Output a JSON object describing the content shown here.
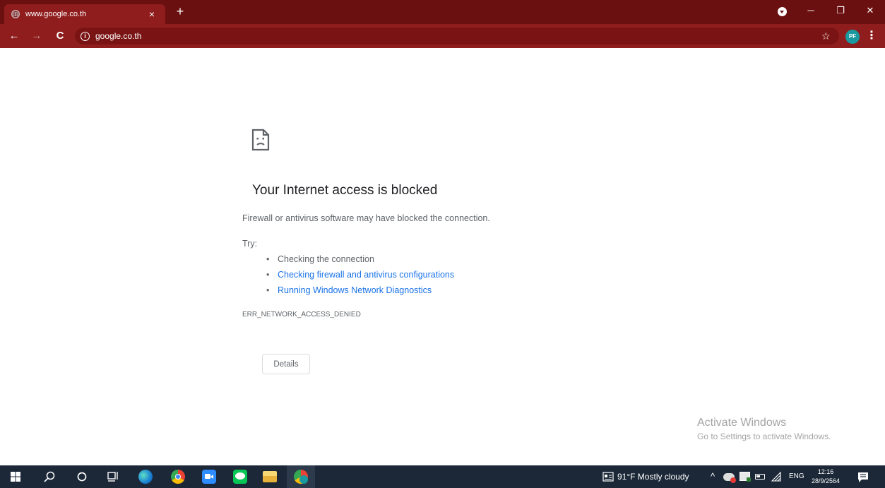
{
  "tab": {
    "title": "www.google.co.th",
    "close": "×"
  },
  "new_tab": "+",
  "window_controls": {
    "minimize": "─",
    "maximize": "❐",
    "close": "✕"
  },
  "nav": {
    "back": "←",
    "forward": "→",
    "reload": "C"
  },
  "omnibox": {
    "info": "i",
    "url": "google.co.th"
  },
  "toolbar_right": {
    "star": "☆",
    "avatar": "PF",
    "menu": "⋮"
  },
  "error_page": {
    "title": "Your Internet access is blocked",
    "description": "Firewall or antivirus software may have blocked the connection.",
    "try_label": "Try:",
    "suggestions": [
      "Checking the connection",
      "Checking firewall and antivirus configurations",
      "Running Windows Network Diagnostics"
    ],
    "error_code": "ERR_NETWORK_ACCESS_DENIED",
    "details_button": "Details"
  },
  "watermark": {
    "line1": "Activate Windows",
    "line2": "Go to Settings to activate Windows."
  },
  "taskbar": {
    "weather": "91°F  Mostly cloudy",
    "language": "ENG",
    "time": "12:16",
    "date": "28/9/2564"
  },
  "colors": {
    "tabstrip": "#6b1010",
    "toolbar": "#8f1d1d",
    "link": "#1a73e8",
    "taskbar": "#1c2838"
  }
}
